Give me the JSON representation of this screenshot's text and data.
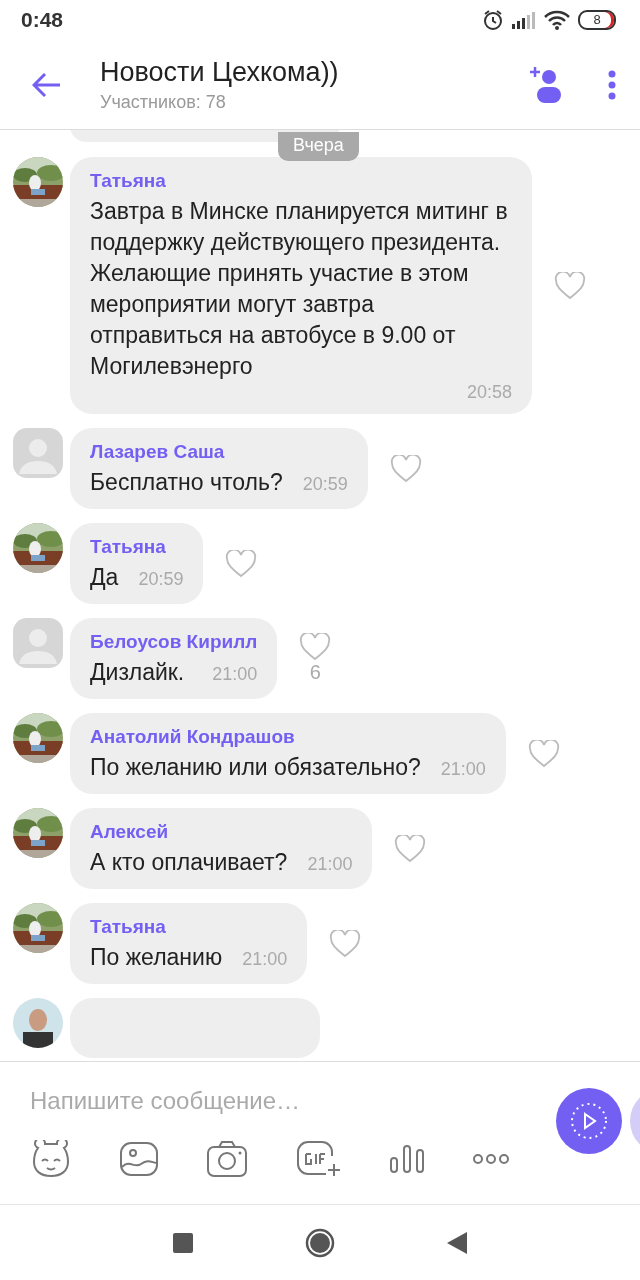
{
  "status_bar": {
    "time": "0:48",
    "battery": "8"
  },
  "header": {
    "title": "Новости Цехкома))",
    "subtitle": "Участников: 78"
  },
  "date_label": "Вчера",
  "messages": [
    {
      "sender": "Татьяна",
      "has_photo": true,
      "text": "Завтра в Минске планируется митинг в поддержку действующего президента. Желающие принять участие в этом мероприятии могут завтра отправиться на автобусе в 9.00 от Могилевэнерго",
      "time": "20:58"
    },
    {
      "sender": "Лазарев Саша",
      "has_photo": false,
      "text": "Бесплатно чтоль?",
      "time": "20:59"
    },
    {
      "sender": "Татьяна",
      "has_photo": true,
      "text": "Да",
      "time": "20:59"
    },
    {
      "sender": "Белоусов Кирилл",
      "has_photo": false,
      "text": "Дизлайк.",
      "time": "21:00",
      "likes": "6"
    },
    {
      "sender": "Анатолий Кондрашов",
      "has_photo": true,
      "text": "По желанию или обязательно?",
      "time": "21:00"
    },
    {
      "sender": "Алексей",
      "has_photo": true,
      "text": "А кто оплачивает?",
      "time": "21:00"
    },
    {
      "sender": "Татьяна",
      "has_photo": true,
      "text": "По желанию",
      "time": "21:00"
    }
  ],
  "composer": {
    "placeholder": "Напишите сообщение…"
  }
}
